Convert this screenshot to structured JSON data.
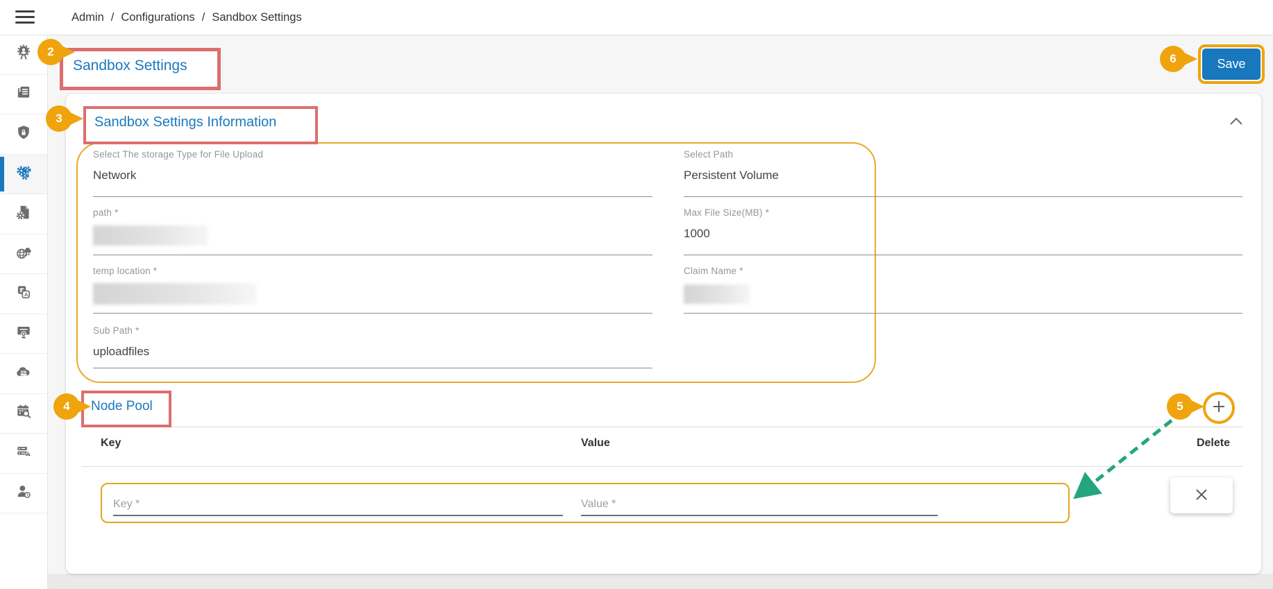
{
  "topbar": {
    "separator": "/",
    "breadcrumb": [
      "Admin",
      "Configurations",
      "Sandbox Settings"
    ]
  },
  "header": {
    "title": "Sandbox Settings",
    "save_button": "Save"
  },
  "sidebar": {
    "items": [
      {
        "icon": "badge-user-icon"
      },
      {
        "icon": "invoice-icon"
      },
      {
        "icon": "shield-lock-icon"
      },
      {
        "icon": "settings-gears-icon",
        "active": true
      },
      {
        "icon": "file-gear-icon"
      },
      {
        "icon": "globe-cloud-icon"
      },
      {
        "icon": "translate-icon"
      },
      {
        "icon": "certificate-icon"
      },
      {
        "icon": "cloud-sync-icon"
      },
      {
        "icon": "calendar-search-icon"
      },
      {
        "icon": "server-alert-icon"
      },
      {
        "icon": "user-history-icon"
      }
    ]
  },
  "section": {
    "title": "Sandbox Settings Information",
    "fields": {
      "storage_type": {
        "label": "Select The storage Type for File Upload",
        "value": "Network"
      },
      "select_path": {
        "label": "Select Path",
        "value": "Persistent Volume"
      },
      "path": {
        "label": "path *",
        "value": "",
        "redacted": true
      },
      "max_file_size": {
        "label": "Max File Size(MB) *",
        "value": "1000"
      },
      "temp_location": {
        "label": "temp location *",
        "value": "",
        "redacted": true
      },
      "claim_name": {
        "label": "Claim Name *",
        "value": "",
        "redacted": true
      },
      "sub_path": {
        "label": "Sub Path *",
        "value": "uploadfiles"
      }
    }
  },
  "node_pool": {
    "title": "Node Pool",
    "columns": {
      "key": "Key",
      "value": "Value",
      "delete": "Delete"
    },
    "new_row": {
      "key_placeholder": "Key *",
      "value_placeholder": "Value *"
    }
  },
  "annotations": {
    "callout_2": "2",
    "callout_3": "3",
    "callout_4": "4",
    "callout_5": "5",
    "callout_6": "6"
  },
  "colors": {
    "accent_orange": "#EFA40D",
    "highlight_red": "#DC6E6E",
    "primary_blue": "#1878BE",
    "arrow_green": "#24A57E"
  }
}
